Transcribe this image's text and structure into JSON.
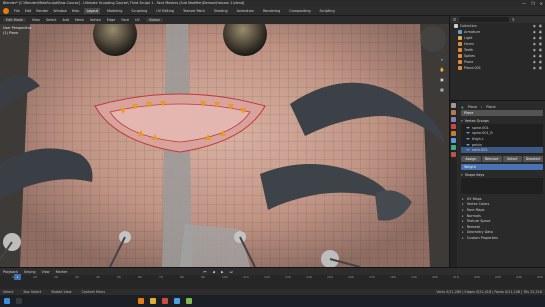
{
  "window": {
    "title": "Blender* [C:\\Render\\MetaSculpt\\Raw-Course] - Ultimate Sculpting Course\\ Third Sculpt 1 - Face Meshes (Sub Modifier\\Demon\\Horizon 2.blend]",
    "controls": [
      "—",
      "❐",
      "✕"
    ]
  },
  "menubar": {
    "menus": [
      "File",
      "Edit",
      "Render",
      "Window",
      "Help"
    ],
    "tabs": [
      "Layout",
      "Modeling",
      "Sculpting",
      "UV Editing",
      "Texture Paint",
      "Shading",
      "Animation",
      "Rendering",
      "Compositing",
      "Scripting"
    ],
    "active_tab": "Layout"
  },
  "viewport_header": {
    "mode": "Edit Mode",
    "items": [
      "View",
      "Select",
      "Add",
      "Mesh",
      "Vertex",
      "Edge",
      "Face",
      "UV"
    ],
    "transform": "Global"
  },
  "viewport": {
    "overlay_line1": "User Perspective",
    "overlay_line2": "(1) Plane"
  },
  "outliner": {
    "items": [
      {
        "name": "Collection",
        "color": "#d0d0d0"
      },
      {
        "name": "Armature",
        "color": "#5fa0d8"
      },
      {
        "name": "Light",
        "color": "#e0b04a"
      },
      {
        "name": "Horns",
        "color": "#e08b3a"
      },
      {
        "name": "Teeth",
        "color": "#e08b3a"
      },
      {
        "name": "Spikes",
        "color": "#e08b3a"
      },
      {
        "name": "Plane",
        "color": "#e08b3a"
      },
      {
        "name": "Plane.001",
        "color": "#e08b3a"
      }
    ]
  },
  "properties": {
    "header_left": "Plane",
    "header_right": "Plane",
    "name_field": "Plane",
    "vertex_groups_title": "Vertex Groups",
    "vertex_groups": [
      "spine.001",
      "spine.001_R",
      "thigh.L",
      "pelvis",
      "neck.001"
    ],
    "vertex_groups_selected": 4,
    "buttons": [
      "Assign",
      "Remove",
      "Select",
      "Deselect"
    ],
    "weight_field": "Weight",
    "shape_keys_title": "Shape Keys",
    "sections": [
      "UV Maps",
      "Vertex Colors",
      "Face Maps",
      "Normals",
      "Texture Space",
      "Remesh",
      "Geometry Data",
      "Custom Properties"
    ]
  },
  "timeline": {
    "menus": [
      "Playback",
      "Keying",
      "View",
      "Marker"
    ],
    "frames": [
      "0",
      "10",
      "20",
      "30",
      "40",
      "50",
      "60",
      "70",
      "80",
      "90",
      "100",
      "110",
      "120",
      "130",
      "140",
      "150",
      "160",
      "170",
      "180",
      "190",
      "200",
      "210",
      "220",
      "230",
      "240",
      "250"
    ],
    "current_frame": "1"
  },
  "statusbar": {
    "left": "Select",
    "mid1": "Box Select",
    "mid2": "Rotate View",
    "mid3": "Context Menu",
    "right": "Verts 0/11,280 | Edges 0/22,418 | Faces 0/11,108 | Tris 22,216"
  },
  "colors": {
    "accent": "#4772b3",
    "brand": "#e87d0d"
  }
}
